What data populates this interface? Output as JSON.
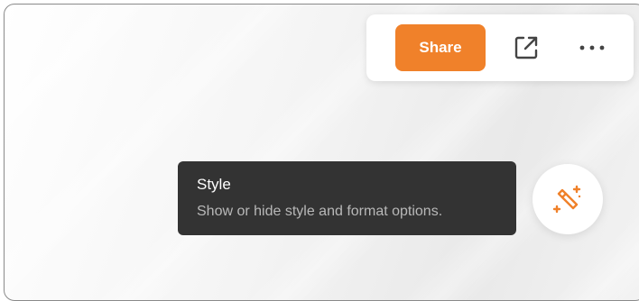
{
  "toolbar": {
    "share_label": "Share",
    "open_external_icon": "open-external-icon",
    "more_options_icon": "more-horizontal-icon"
  },
  "tooltip": {
    "title": "Style",
    "description": "Show or hide style and format options."
  },
  "style_button": {
    "icon": "magic-wand-sparkle-icon"
  },
  "colors": {
    "accent": "#f0812a",
    "tooltip_bg": "#333333",
    "tooltip_desc": "#b8b8b8",
    "icon_dark": "#444444"
  }
}
